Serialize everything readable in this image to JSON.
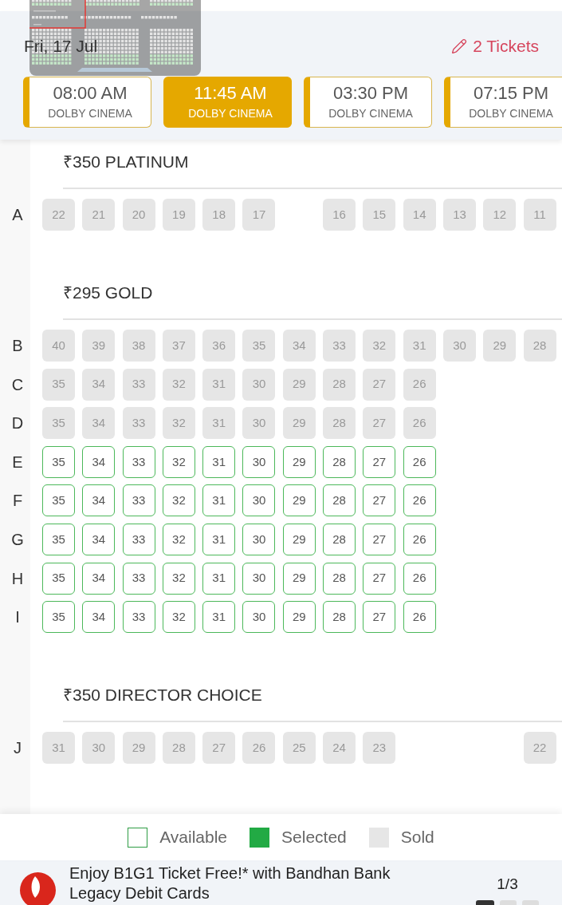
{
  "header": {
    "date": "Fri, 17 Jul",
    "tickets": "2 Tickets"
  },
  "showtimes": [
    {
      "time": "08:00 AM",
      "format": "DOLBY CINEMA",
      "selected": false
    },
    {
      "time": "11:45 AM",
      "format": "DOLBY CINEMA",
      "selected": true
    },
    {
      "time": "03:30 PM",
      "format": "DOLBY CINEMA",
      "selected": false
    },
    {
      "time": "07:15 PM",
      "format": "DOLBY CINEMA",
      "selected": false
    }
  ],
  "sections": [
    {
      "title": "₹350 PLATINUM",
      "rows": [
        {
          "label": "A",
          "seats": [
            {
              "kind": "seat",
              "number": "22",
              "sold": true
            },
            {
              "kind": "seat",
              "number": "21",
              "sold": true
            },
            {
              "kind": "seat",
              "number": "20",
              "sold": true
            },
            {
              "kind": "seat",
              "number": "19",
              "sold": true
            },
            {
              "kind": "seat",
              "number": "18",
              "sold": true
            },
            {
              "kind": "seat",
              "number": "17",
              "sold": true
            },
            {
              "kind": "gap"
            },
            {
              "kind": "seat",
              "number": "16",
              "sold": true
            },
            {
              "kind": "seat",
              "number": "15",
              "sold": true
            },
            {
              "kind": "seat",
              "number": "14",
              "sold": true
            },
            {
              "kind": "seat",
              "number": "13",
              "sold": true
            },
            {
              "kind": "seat",
              "number": "12",
              "sold": true
            },
            {
              "kind": "seat",
              "number": "11",
              "sold": true
            }
          ]
        }
      ]
    },
    {
      "title": "₹295 GOLD",
      "rows": [
        {
          "label": "B",
          "seats": [
            {
              "kind": "seat",
              "number": "40",
              "sold": true
            },
            {
              "kind": "seat",
              "number": "39",
              "sold": true
            },
            {
              "kind": "seat",
              "number": "38",
              "sold": true
            },
            {
              "kind": "seat",
              "number": "37",
              "sold": true
            },
            {
              "kind": "seat",
              "number": "36",
              "sold": true
            },
            {
              "kind": "seat",
              "number": "35",
              "sold": true
            },
            {
              "kind": "seat",
              "number": "34",
              "sold": true
            },
            {
              "kind": "seat",
              "number": "33",
              "sold": true
            },
            {
              "kind": "seat",
              "number": "32",
              "sold": true
            },
            {
              "kind": "seat",
              "number": "31",
              "sold": true
            },
            {
              "kind": "seat",
              "number": "30",
              "sold": true
            },
            {
              "kind": "seat",
              "number": "29",
              "sold": true
            },
            {
              "kind": "seat",
              "number": "28",
              "sold": true
            }
          ]
        },
        {
          "label": "C",
          "seats": [
            {
              "kind": "seat",
              "number": "35",
              "sold": true
            },
            {
              "kind": "seat",
              "number": "34",
              "sold": true
            },
            {
              "kind": "seat",
              "number": "33",
              "sold": true
            },
            {
              "kind": "seat",
              "number": "32",
              "sold": true
            },
            {
              "kind": "seat",
              "number": "31",
              "sold": true
            },
            {
              "kind": "seat",
              "number": "30",
              "sold": true
            },
            {
              "kind": "seat",
              "number": "29",
              "sold": true
            },
            {
              "kind": "seat",
              "number": "28",
              "sold": true
            },
            {
              "kind": "seat",
              "number": "27",
              "sold": true
            },
            {
              "kind": "seat",
              "number": "26",
              "sold": true
            }
          ]
        },
        {
          "label": "D",
          "seats": [
            {
              "kind": "seat",
              "number": "35",
              "sold": true
            },
            {
              "kind": "seat",
              "number": "34",
              "sold": true
            },
            {
              "kind": "seat",
              "number": "33",
              "sold": true
            },
            {
              "kind": "seat",
              "number": "32",
              "sold": true
            },
            {
              "kind": "seat",
              "number": "31",
              "sold": true
            },
            {
              "kind": "seat",
              "number": "30",
              "sold": true
            },
            {
              "kind": "seat",
              "number": "29",
              "sold": true
            },
            {
              "kind": "seat",
              "number": "28",
              "sold": true
            },
            {
              "kind": "seat",
              "number": "27",
              "sold": true
            },
            {
              "kind": "seat",
              "number": "26",
              "sold": true
            }
          ]
        },
        {
          "label": "E",
          "seats": [
            {
              "kind": "seat",
              "number": "35",
              "sold": false
            },
            {
              "kind": "seat",
              "number": "34",
              "sold": false
            },
            {
              "kind": "seat",
              "number": "33",
              "sold": false
            },
            {
              "kind": "seat",
              "number": "32",
              "sold": false
            },
            {
              "kind": "seat",
              "number": "31",
              "sold": false
            },
            {
              "kind": "seat",
              "number": "30",
              "sold": false
            },
            {
              "kind": "seat",
              "number": "29",
              "sold": false
            },
            {
              "kind": "seat",
              "number": "28",
              "sold": false
            },
            {
              "kind": "seat",
              "number": "27",
              "sold": false
            },
            {
              "kind": "seat",
              "number": "26",
              "sold": false
            }
          ]
        },
        {
          "label": "F",
          "seats": [
            {
              "kind": "seat",
              "number": "35",
              "sold": false
            },
            {
              "kind": "seat",
              "number": "34",
              "sold": false
            },
            {
              "kind": "seat",
              "number": "33",
              "sold": false
            },
            {
              "kind": "seat",
              "number": "32",
              "sold": false
            },
            {
              "kind": "seat",
              "number": "31",
              "sold": false
            },
            {
              "kind": "seat",
              "number": "30",
              "sold": false
            },
            {
              "kind": "seat",
              "number": "29",
              "sold": false
            },
            {
              "kind": "seat",
              "number": "28",
              "sold": false
            },
            {
              "kind": "seat",
              "number": "27",
              "sold": false
            },
            {
              "kind": "seat",
              "number": "26",
              "sold": false
            }
          ]
        },
        {
          "label": "G",
          "seats": [
            {
              "kind": "seat",
              "number": "35",
              "sold": false
            },
            {
              "kind": "seat",
              "number": "34",
              "sold": false
            },
            {
              "kind": "seat",
              "number": "33",
              "sold": false
            },
            {
              "kind": "seat",
              "number": "32",
              "sold": false
            },
            {
              "kind": "seat",
              "number": "31",
              "sold": false
            },
            {
              "kind": "seat",
              "number": "30",
              "sold": false
            },
            {
              "kind": "seat",
              "number": "29",
              "sold": false
            },
            {
              "kind": "seat",
              "number": "28",
              "sold": false
            },
            {
              "kind": "seat",
              "number": "27",
              "sold": false
            },
            {
              "kind": "seat",
              "number": "26",
              "sold": false
            }
          ]
        },
        {
          "label": "H",
          "seats": [
            {
              "kind": "seat",
              "number": "35",
              "sold": false
            },
            {
              "kind": "seat",
              "number": "34",
              "sold": false
            },
            {
              "kind": "seat",
              "number": "33",
              "sold": false
            },
            {
              "kind": "seat",
              "number": "32",
              "sold": false
            },
            {
              "kind": "seat",
              "number": "31",
              "sold": false
            },
            {
              "kind": "seat",
              "number": "30",
              "sold": false
            },
            {
              "kind": "seat",
              "number": "29",
              "sold": false
            },
            {
              "kind": "seat",
              "number": "28",
              "sold": false
            },
            {
              "kind": "seat",
              "number": "27",
              "sold": false
            },
            {
              "kind": "seat",
              "number": "26",
              "sold": false
            }
          ]
        },
        {
          "label": "I",
          "seats": [
            {
              "kind": "seat",
              "number": "35",
              "sold": false
            },
            {
              "kind": "seat",
              "number": "34",
              "sold": false
            },
            {
              "kind": "seat",
              "number": "33",
              "sold": false
            },
            {
              "kind": "seat",
              "number": "32",
              "sold": false
            },
            {
              "kind": "seat",
              "number": "31",
              "sold": false
            },
            {
              "kind": "seat",
              "number": "30",
              "sold": false
            },
            {
              "kind": "seat",
              "number": "29",
              "sold": false
            },
            {
              "kind": "seat",
              "number": "28",
              "sold": false
            },
            {
              "kind": "seat",
              "number": "27",
              "sold": false
            },
            {
              "kind": "seat",
              "number": "26",
              "sold": false
            }
          ]
        }
      ]
    },
    {
      "title": "₹350 DIRECTOR CHOICE",
      "rows": [
        {
          "label": "J",
          "seats": [
            {
              "kind": "seat",
              "number": "31",
              "sold": true
            },
            {
              "kind": "seat",
              "number": "30",
              "sold": true
            },
            {
              "kind": "seat",
              "number": "29",
              "sold": true
            },
            {
              "kind": "seat",
              "number": "28",
              "sold": true
            },
            {
              "kind": "seat",
              "number": "27",
              "sold": true
            },
            {
              "kind": "seat",
              "number": "26",
              "sold": true
            },
            {
              "kind": "seat",
              "number": "25",
              "sold": true
            },
            {
              "kind": "seat",
              "number": "24",
              "sold": true
            },
            {
              "kind": "seat",
              "number": "23",
              "sold": true
            },
            {
              "kind": "gap"
            },
            {
              "kind": "gap"
            },
            {
              "kind": "gap"
            },
            {
              "kind": "seat",
              "number": "22",
              "sold": true
            }
          ]
        }
      ]
    }
  ],
  "legend": [
    {
      "label": "Available",
      "kind": "available"
    },
    {
      "label": "Selected",
      "kind": "selected"
    },
    {
      "label": "Sold",
      "kind": "sold"
    }
  ],
  "offer": {
    "text": "Enjoy B1G1 Ticket Free!* with Bandhan Bank Legacy Debit Cards",
    "page": "1/3",
    "dots": [
      {
        "selected": true
      },
      {
        "selected": false
      },
      {
        "selected": false
      }
    ]
  }
}
